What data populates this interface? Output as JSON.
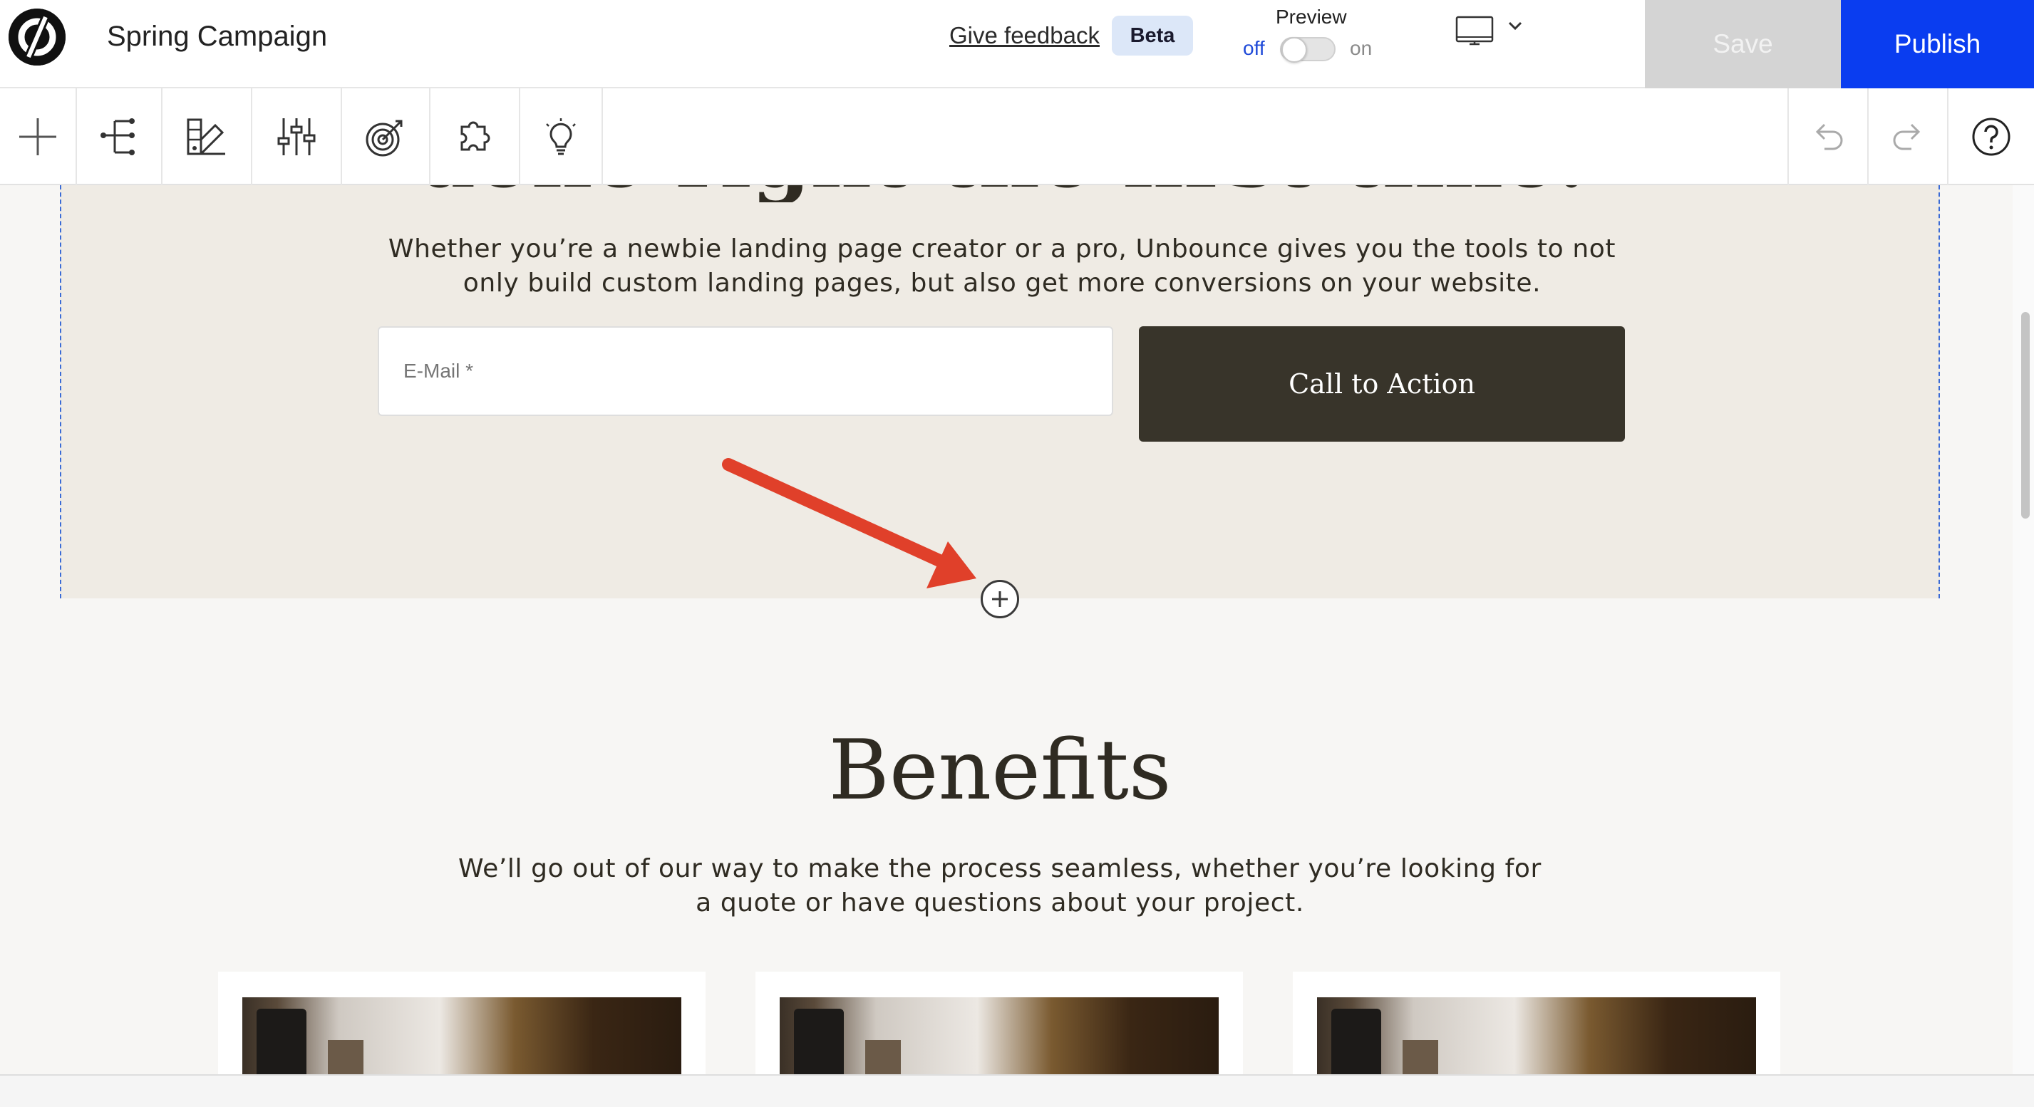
{
  "header": {
    "title": "Spring Campaign",
    "feedback_label": "Give feedback",
    "beta_label": "Beta",
    "preview": {
      "label": "Preview",
      "off_label": "off",
      "on_label": "on",
      "state": "off"
    },
    "device_icon": "desktop-icon",
    "save_label": "Save",
    "publish_label": "Publish"
  },
  "toolbar": {
    "items": [
      {
        "name": "add-element",
        "icon": "plus-icon"
      },
      {
        "name": "page-hierarchy",
        "icon": "tree-icon"
      },
      {
        "name": "page-styles",
        "icon": "palette-icon"
      },
      {
        "name": "settings",
        "icon": "sliders-icon"
      },
      {
        "name": "goals",
        "icon": "target-icon"
      },
      {
        "name": "integrations",
        "icon": "puzzle-icon"
      },
      {
        "name": "tips",
        "icon": "lightbulb-icon"
      }
    ],
    "right_items": [
      {
        "name": "undo",
        "icon": "undo-icon"
      },
      {
        "name": "redo",
        "icon": "redo-icon"
      },
      {
        "name": "help",
        "icon": "help-icon"
      }
    ]
  },
  "page": {
    "hero": {
      "heading": "done right the first time.",
      "text": "Whether you’re a newbie landing page creator or a pro, Unbounce gives you the tools to not only build custom landing pages, but also get more conversions on your website.",
      "email_placeholder": "E-Mail *",
      "cta_label": "Call to Action"
    },
    "add_section_icon": "plus-circle-icon",
    "benefits": {
      "title": "Benefits",
      "text": "We’ll go out of our way to make the process seamless, whether you’re looking for a quote or have questions about your project."
    }
  },
  "colors": {
    "publish": "#0a3df0",
    "save_disabled": "#d4d4d4",
    "hero_bg": "#efebe4",
    "cta_bg": "#38342a",
    "annotation_arrow": "#e0402a"
  }
}
